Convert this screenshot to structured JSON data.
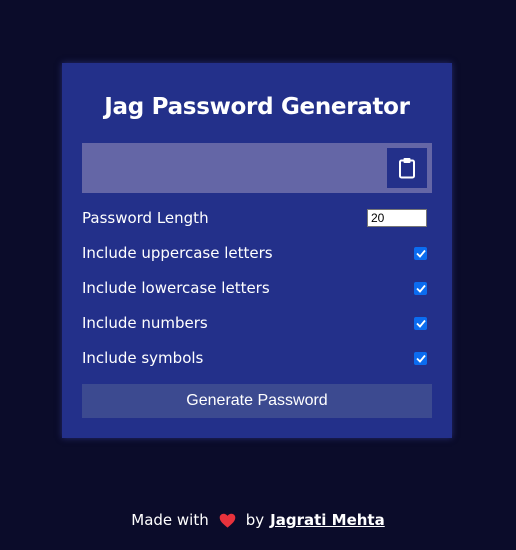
{
  "app": {
    "title": "Jag Password Generator"
  },
  "result": {
    "value": "",
    "copy_icon": "clipboard-icon"
  },
  "settings": {
    "length_label": "Password Length",
    "length_value": "20",
    "uppercase_label": "Include uppercase letters",
    "uppercase_checked": true,
    "lowercase_label": "Include lowercase letters",
    "lowercase_checked": true,
    "numbers_label": "Include numbers",
    "numbers_checked": true,
    "symbols_label": "Include symbols",
    "symbols_checked": true
  },
  "generate_button": {
    "label": "Generate Password"
  },
  "footer": {
    "made_with": "Made with",
    "heart_icon": "heart-icon",
    "by": "by",
    "author": "Jagrati Mehta"
  },
  "colors": {
    "page_bg": "#0b0c2a",
    "card_bg": "#23308a",
    "result_bg": "#6466a6",
    "button_bg": "#3c4a90",
    "checkbox": "#0b6cf0",
    "heart": "#e8323c"
  }
}
